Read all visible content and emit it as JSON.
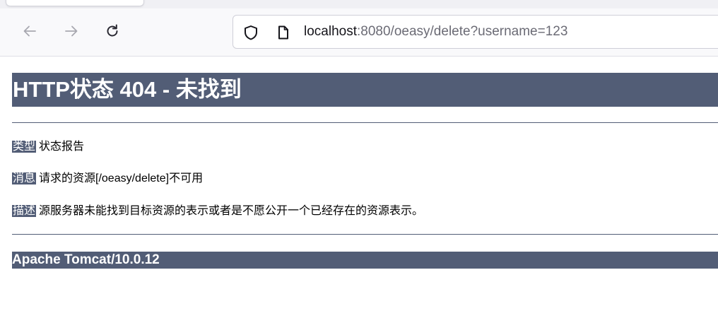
{
  "browser": {
    "url_host": "localhost",
    "url_rest": ":8080/oeasy/delete?username=123",
    "icons": {
      "back": "back-arrow-icon",
      "forward": "forward-arrow-icon",
      "reload": "reload-icon",
      "tracking": "shield-icon",
      "page": "page-info-icon"
    }
  },
  "page": {
    "title": "HTTP状态 404 - 未找到",
    "type_label": "类型",
    "type_value": "状态报告",
    "message_label": "消息",
    "message_value": "请求的资源[/oeasy/delete]不可用",
    "description_label": "描述",
    "description_value": "源服务器未能找到目标资源的表示或者是不愿公开一个已经存在的资源表示。",
    "server_footer": "Apache Tomcat/10.0.12"
  },
  "colors": {
    "tomcat_banner": "#525d76",
    "toolbar_bg": "#f9f9fb",
    "tabstrip_bg": "#f0f0f4"
  }
}
